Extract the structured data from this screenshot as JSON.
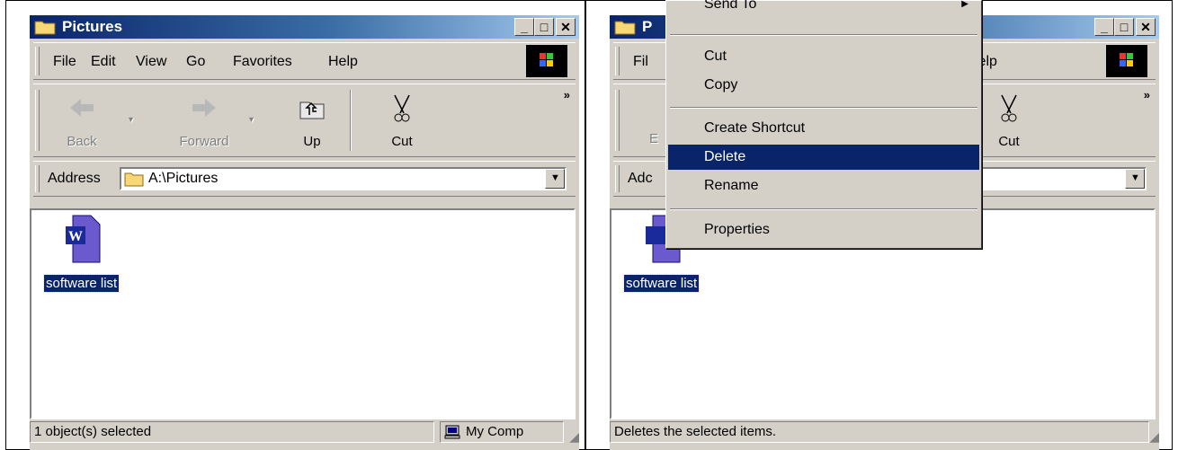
{
  "left_window": {
    "title": "Pictures",
    "menu": [
      "File",
      "Edit",
      "View",
      "Go",
      "Favorites",
      "Help"
    ],
    "toolbar": {
      "back": "Back",
      "forward": "Forward",
      "up": "Up",
      "cut": "Cut",
      "more": "»"
    },
    "address_label": "Address",
    "address_value": "A:\\Pictures",
    "file_name": "software list",
    "status_text": "1 object(s) selected",
    "status_zone": "My Comp"
  },
  "right_window": {
    "title_partial": "P",
    "menu_partial_file": "Fil",
    "menu_partial_help": "lelp",
    "address_partial": "Adc",
    "toolbar_cut": "Cut",
    "toolbar_partial": "E",
    "more": "»",
    "file_name": "software list",
    "status_text": "Deletes the selected items."
  },
  "context_menu": {
    "items": [
      "Send To",
      "Cut",
      "Copy",
      "Create Shortcut",
      "Delete",
      "Rename",
      "Properties"
    ],
    "selected": "Delete"
  },
  "colors": {
    "title_start": "#0a246a",
    "title_end": "#a6caf0",
    "face": "#d4d0c8",
    "highlight": "#0a246a"
  }
}
